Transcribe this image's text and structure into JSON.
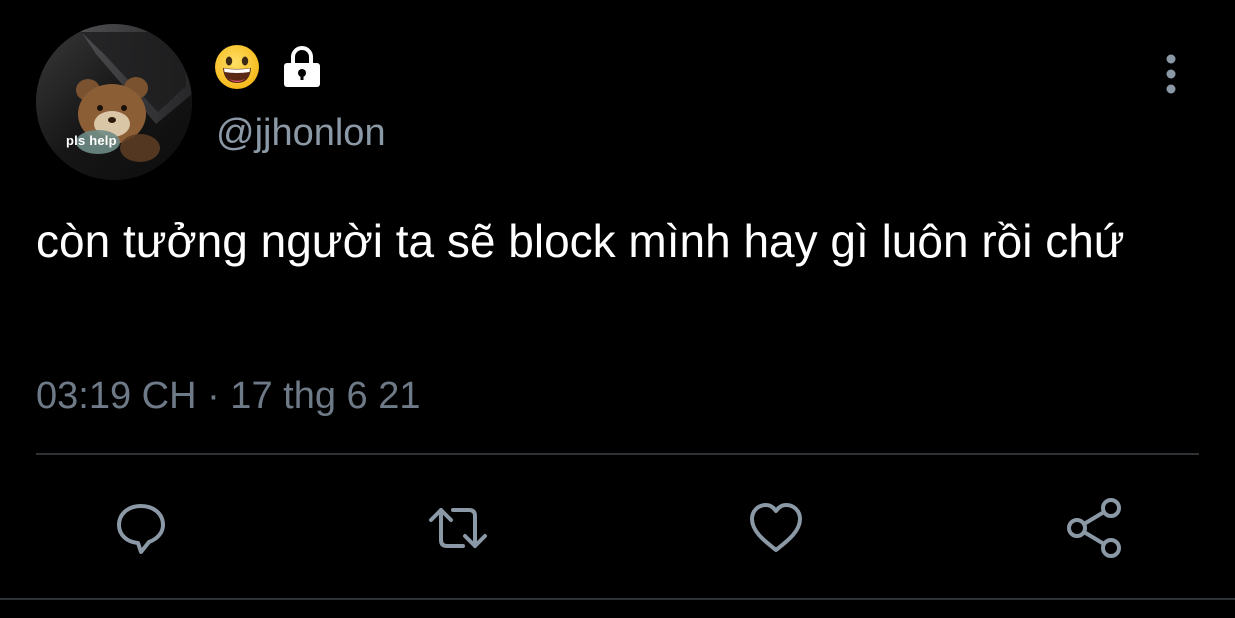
{
  "profile": {
    "avatar_caption": "pls help",
    "handle": "@jjhonlon",
    "name_icons": [
      "grinning-face-emoji",
      "lock-icon"
    ]
  },
  "tweet": {
    "text": "còn tưởng người ta sẽ block mình hay gì luôn rồi chứ",
    "timestamp": "03:19 CH · 17 thg 6 21"
  },
  "actions": {
    "reply": "reply-icon",
    "retweet": "retweet-icon",
    "like": "heart-icon",
    "share": "share-icon"
  },
  "colors": {
    "background": "#000000",
    "text": "#ffffff",
    "secondary": "#8b98a5",
    "meta": "#6e7a87",
    "icon": "#8b98a5",
    "divider": "#2f3336"
  }
}
